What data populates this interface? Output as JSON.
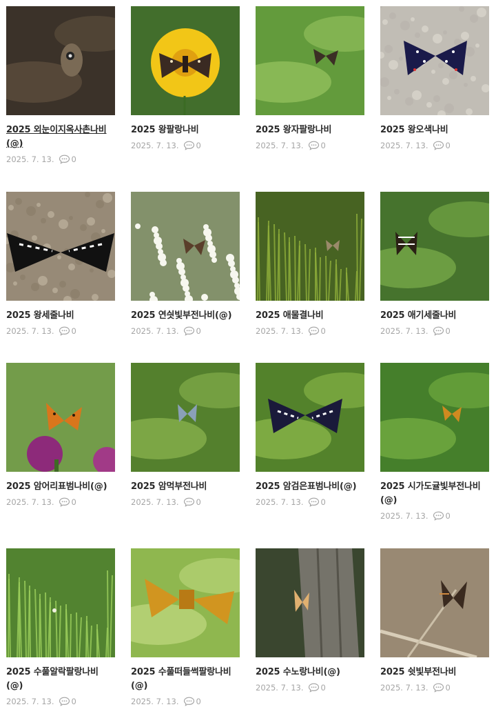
{
  "posts": [
    {
      "title": "2025 외눈이지옥사촌나비(@)",
      "date": "2025. 7. 13.",
      "comments": "0",
      "active": true,
      "photo": {
        "bg": "#2b2520",
        "bg2": "#6b5a45",
        "accent": "#7a6a55",
        "kind": "brown-eye"
      }
    },
    {
      "title": "2025 왕팔랑나비",
      "date": "2025. 7. 13.",
      "comments": "0",
      "photo": {
        "bg": "#2f5a22",
        "bg2": "#7bab4d",
        "accent": "#f2c617",
        "kind": "flower-brown"
      }
    },
    {
      "title": "2025 왕자팔랑나비",
      "date": "2025. 7. 13.",
      "comments": "0",
      "photo": {
        "bg": "#4d8a2c",
        "bg2": "#a8d06a",
        "accent": "#3b2f25",
        "kind": "leaf-dark"
      }
    },
    {
      "title": "2025 왕오색나비",
      "date": "2025. 7. 13.",
      "comments": "0",
      "photo": {
        "bg": "#b8b4ac",
        "bg2": "#dcd8cf",
        "accent": "#1a1a4a",
        "kind": "stone-blue"
      }
    },
    {
      "title": "2025 왕세줄나비",
      "date": "2025. 7. 13.",
      "comments": "0",
      "photo": {
        "bg": "#8a7d6a",
        "bg2": "#bfb3a0",
        "accent": "#111111",
        "kind": "gravel-stripe"
      }
    },
    {
      "title": "2025 연싓빛부전나비(@)",
      "date": "2025. 7. 13.",
      "comments": "0",
      "photo": {
        "bg": "#5a6d3a",
        "bg2": "#ffffff",
        "accent": "#5a3e2a",
        "kind": "white-flowers"
      }
    },
    {
      "title": "2025 애물결나비",
      "date": "2025. 7. 13.",
      "comments": "0",
      "photo": {
        "bg": "#2f4a1a",
        "bg2": "#8fae3a",
        "accent": "#9a8a6a",
        "kind": "grass-small"
      }
    },
    {
      "title": "2025 애기세줄나비",
      "date": "2025. 7. 13.",
      "comments": "0",
      "photo": {
        "bg": "#2f5a20",
        "bg2": "#8cc053",
        "accent": "#2a2015",
        "kind": "leaf-stripe"
      }
    },
    {
      "title": "2025 암어리표범나비(@)",
      "date": "2025. 7. 13.",
      "comments": "0",
      "photo": {
        "bg": "#5c8a3a",
        "bg2": "#b6d47a",
        "accent": "#d9761c",
        "kind": "thistle-orange"
      }
    },
    {
      "title": "2025 암먹부전나비",
      "date": "2025. 7. 13.",
      "comments": "0",
      "photo": {
        "bg": "#3d6a1e",
        "bg2": "#9cc55a",
        "accent": "#8aa0b8",
        "kind": "leaf-blue"
      }
    },
    {
      "title": "2025 암검은표범나비(@)",
      "date": "2025. 7. 13.",
      "comments": "0",
      "photo": {
        "bg": "#3a6a1e",
        "bg2": "#a0cc55",
        "accent": "#1a1a3a",
        "kind": "leaf-bigblue"
      }
    },
    {
      "title": "2025 시가도귤빛부전나비(@)",
      "date": "2025. 7. 13.",
      "comments": "0",
      "photo": {
        "bg": "#2f6a20",
        "bg2": "#86c04a",
        "accent": "#d08a20",
        "kind": "leaf-small-orange"
      }
    },
    {
      "title": "2025 수풀알락팔랑나비(@)",
      "date": "2025. 7. 13.",
      "comments": "0",
      "photo": {
        "bg": "#3a6a22",
        "bg2": "#9ccf5c",
        "accent": "#2a2a15",
        "kind": "grass-dense"
      }
    },
    {
      "title": "2025 수풀떠들썩팔랑나비(@)",
      "date": "2025. 7. 13.",
      "comments": "0",
      "photo": {
        "bg": "#7aa83a",
        "bg2": "#cfe48f",
        "accent": "#d19520",
        "kind": "skipper-orange"
      }
    },
    {
      "title": "2025 수노랑나비(@)",
      "date": "2025. 7. 13.",
      "comments": "0",
      "photo": {
        "bg": "#2a3a20",
        "bg2": "#6a6a5c",
        "accent": "#e0b070",
        "kind": "tree-trunk"
      }
    },
    {
      "title": "2025 쉿빛부전나비",
      "date": "2025. 7. 13.",
      "comments": "0",
      "photo": {
        "bg": "#8a7a65",
        "bg2": "#c9b9a0",
        "accent": "#3a2a1f",
        "kind": "twig-brown"
      }
    }
  ]
}
